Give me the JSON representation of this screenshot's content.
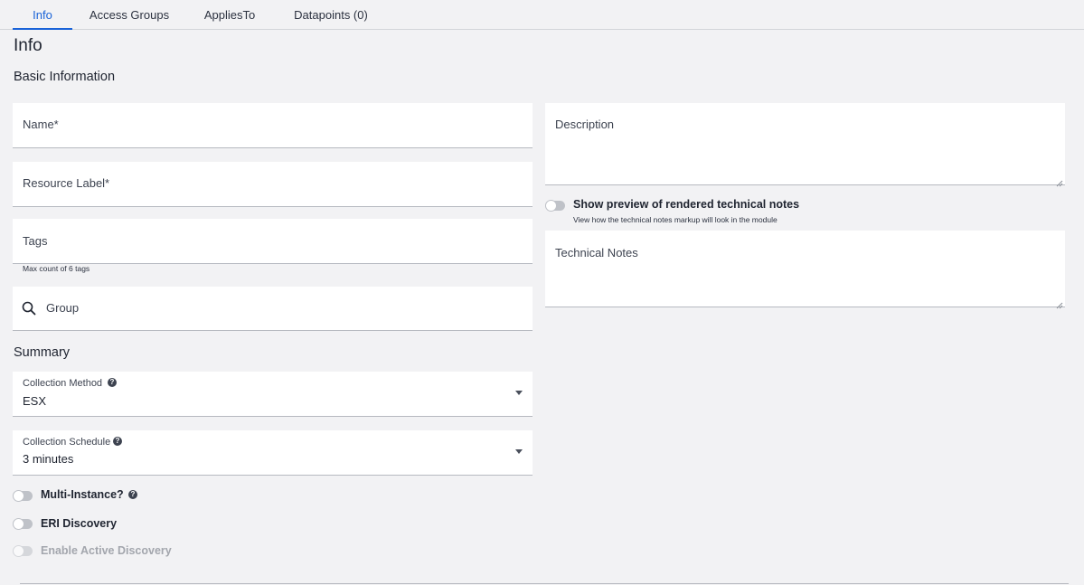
{
  "tabs": [
    {
      "label": "Info",
      "active": true
    },
    {
      "label": "Access Groups",
      "active": false
    },
    {
      "label": "AppliesTo",
      "active": false
    },
    {
      "label": "Datapoints (0)",
      "active": false
    }
  ],
  "page_title": "Info",
  "basic_info": {
    "title": "Basic Information",
    "name_placeholder": "Name*",
    "resource_label_placeholder": "Resource Label*",
    "tags_placeholder": "Tags",
    "tags_hint": "Max count of 6 tags",
    "group_placeholder": "Group"
  },
  "summary": {
    "title": "Summary",
    "collection_method": {
      "label": "Collection Method",
      "value": "ESX"
    },
    "collection_schedule": {
      "label": "Collection Schedule",
      "value": "3 minutes"
    },
    "toggles": [
      {
        "label": "Multi-Instance?",
        "on": false,
        "disabled": false
      },
      {
        "label": "ERI Discovery",
        "on": false,
        "disabled": false
      },
      {
        "label": "Enable Active Discovery",
        "on": false,
        "disabled": true
      }
    ]
  },
  "right": {
    "description_placeholder": "Description",
    "preview_toggle_label": "Show preview of rendered technical notes",
    "preview_toggle_hint": "View how the technical notes markup will look in the module",
    "technical_notes_placeholder": "Technical Notes"
  },
  "colors": {
    "accent": "#1a63d8",
    "background": "#f2f2f4"
  }
}
